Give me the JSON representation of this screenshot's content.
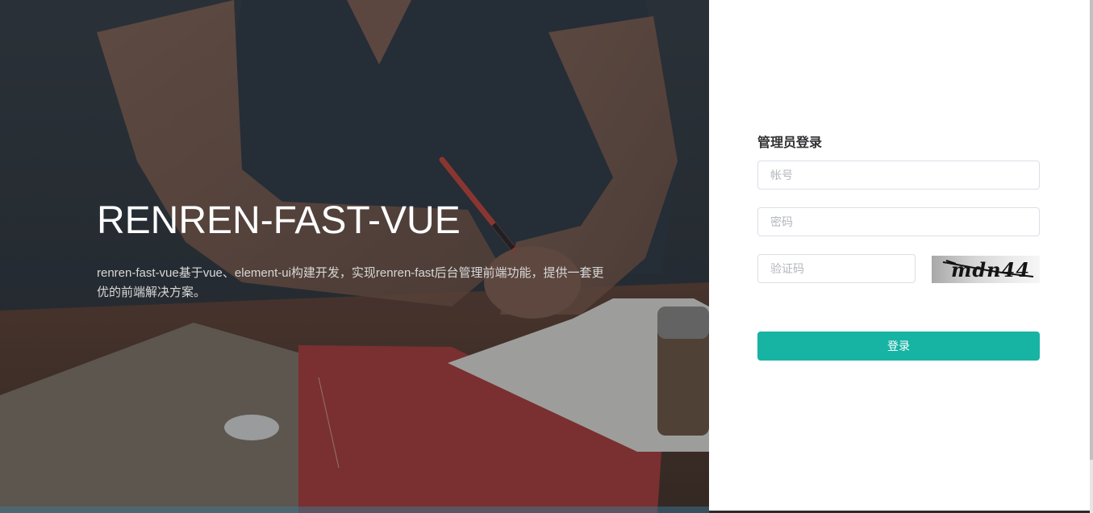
{
  "hero": {
    "title": "RENREN-FAST-VUE",
    "description": "renren-fast-vue基于vue、element-ui构建开发，实现renren-fast后台管理前端功能，提供一套更优的前端解决方案。"
  },
  "login": {
    "title": "管理员登录",
    "username_placeholder": "帐号",
    "password_placeholder": "密码",
    "captcha_placeholder": "验证码",
    "captcha_text": "mdn44",
    "submit_label": "登录"
  },
  "colors": {
    "accent": "#17b3a3",
    "hero_text": "#ffffff",
    "panel_bg": "#ffffff"
  }
}
